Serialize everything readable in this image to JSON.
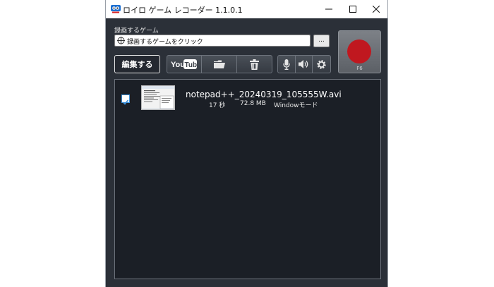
{
  "window": {
    "title": "ロイロ ゲーム レコーダー 1.1.0.1",
    "min_icon": "minimize-icon",
    "max_icon": "maximize-icon",
    "close_icon": "close-icon"
  },
  "game_select": {
    "label": "録画するゲーム",
    "placeholder": "録画するゲームをクリック",
    "browse_label": "..."
  },
  "toolbar": {
    "edit_label": "編集する",
    "youtube_label": "YouTube",
    "icons": [
      "youtube-icon",
      "folder-icon",
      "trash-icon",
      "microphone-icon",
      "speaker-icon",
      "gear-icon"
    ]
  },
  "record": {
    "hotkey": "F6",
    "color": "#c0181f"
  },
  "recordings": [
    {
      "filename": "notepad++_20240319_105555W.avi",
      "duration": "17 秒",
      "size": "72.8 MB",
      "mode": "Windowモード",
      "checked": true
    }
  ],
  "colors": {
    "window_bg": "#2b3038",
    "list_bg": "#1b1f26",
    "accent": "#3a8fd8"
  }
}
